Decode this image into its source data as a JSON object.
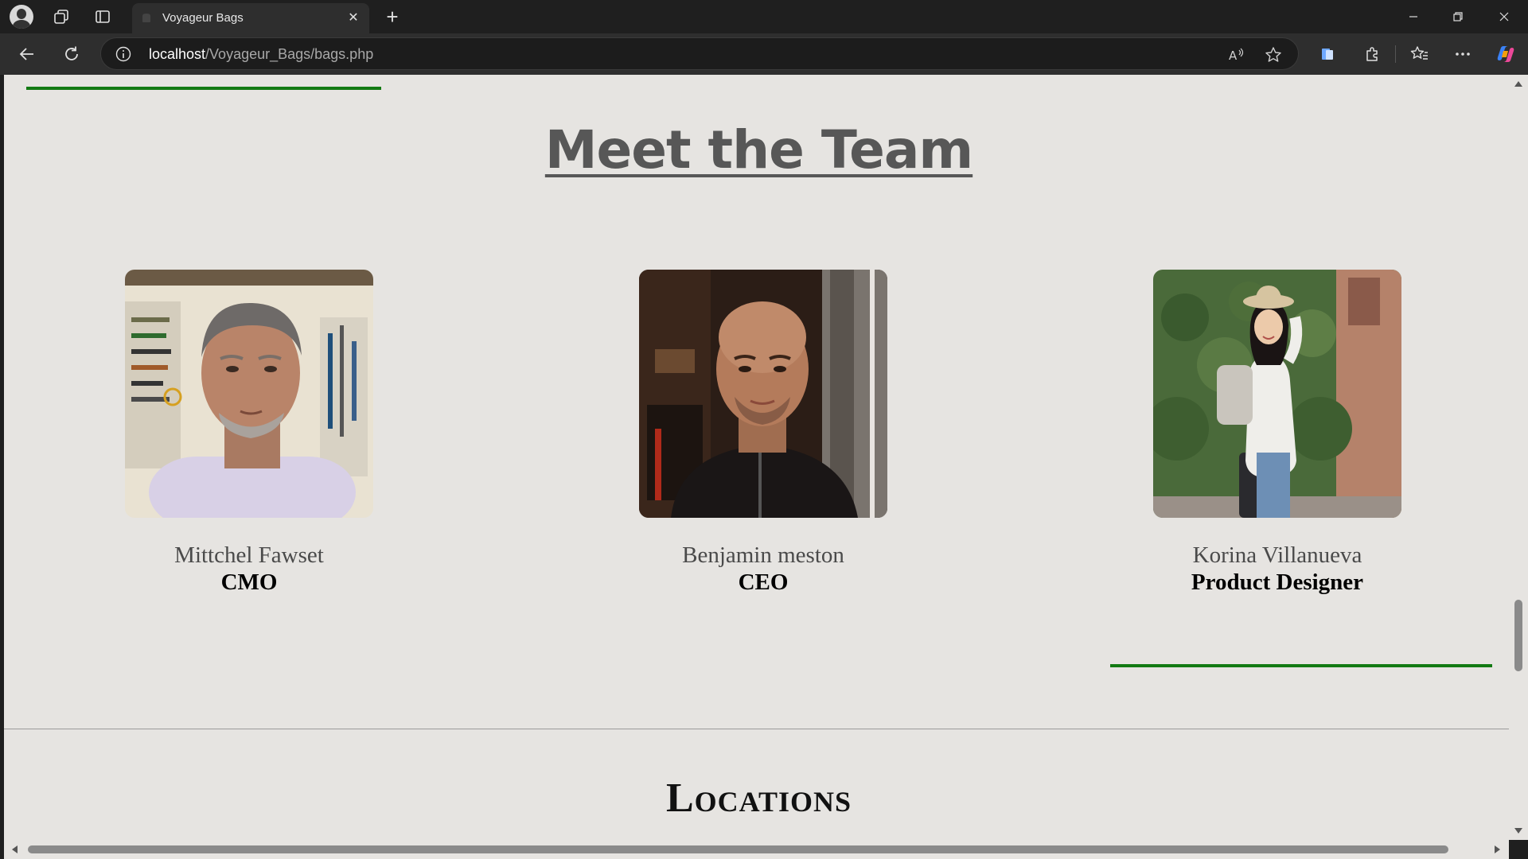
{
  "browser": {
    "tab_title": "Voyageur Bags",
    "url_host": "localhost",
    "url_path": "/Voyageur_Bags/bags.php"
  },
  "page": {
    "team_heading": "Meet the Team",
    "members": [
      {
        "name": "Mittchel Fawset",
        "role": "CMO"
      },
      {
        "name": "Benjamin meston",
        "role": "CEO"
      },
      {
        "name": "Korina Villanueva",
        "role": "Product Designer"
      }
    ],
    "locations_heading": "Locations"
  },
  "colors": {
    "page_bg": "#e6e4e1",
    "accent_green": "#137a13",
    "heading_gray": "#575757"
  },
  "icons": [
    "profile-avatar-icon",
    "workspaces-icon",
    "tab-actions-icon",
    "close-icon",
    "new-tab-icon",
    "minimize-icon",
    "restore-icon",
    "window-close-icon",
    "back-icon",
    "refresh-icon",
    "site-info-icon",
    "read-aloud-icon",
    "favorite-star-icon",
    "collections-icon",
    "extensions-icon",
    "favorites-icon",
    "more-icon",
    "copilot-icon"
  ]
}
